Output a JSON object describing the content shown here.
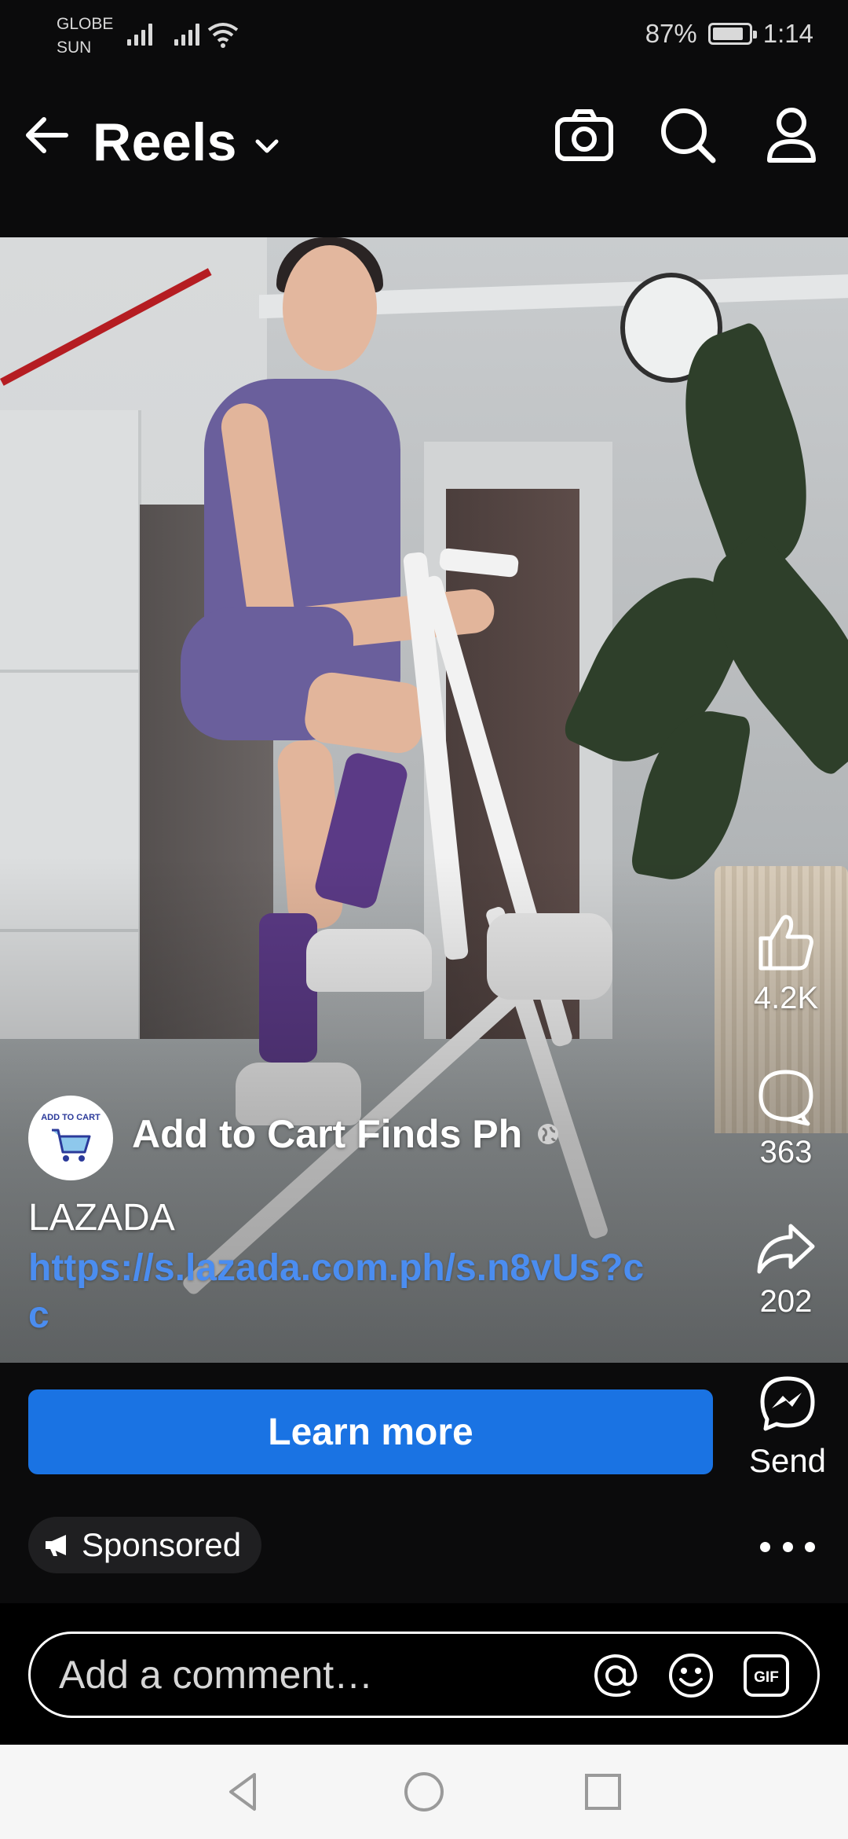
{
  "status_bar": {
    "carrier_line1": "GLOBE",
    "carrier_line2": "SUN",
    "battery_percent": "87%",
    "battery_level": 0.87,
    "time": "1:14"
  },
  "header": {
    "title": "Reels",
    "icons": [
      "arrow-left-icon",
      "chevron-down-icon",
      "camera-icon",
      "search-icon",
      "profile-icon"
    ]
  },
  "reel": {
    "page_name": "Add to Cart Finds Ph",
    "avatar_text": "ADD TO CART",
    "caption": "LAZADA",
    "link": "https://s.lazada.com.ph/s.n8vUs?cc",
    "actions": {
      "likes": "4.2K",
      "comments": "363",
      "shares": "202",
      "send_label": "Send"
    },
    "cta_label": "Learn more",
    "sponsored_label": "Sponsored"
  },
  "comment": {
    "placeholder": "Add a comment…"
  },
  "colors": {
    "cta_blue": "#1a73e3",
    "link_blue": "#4b8df0",
    "background": "#0b0b0c"
  }
}
